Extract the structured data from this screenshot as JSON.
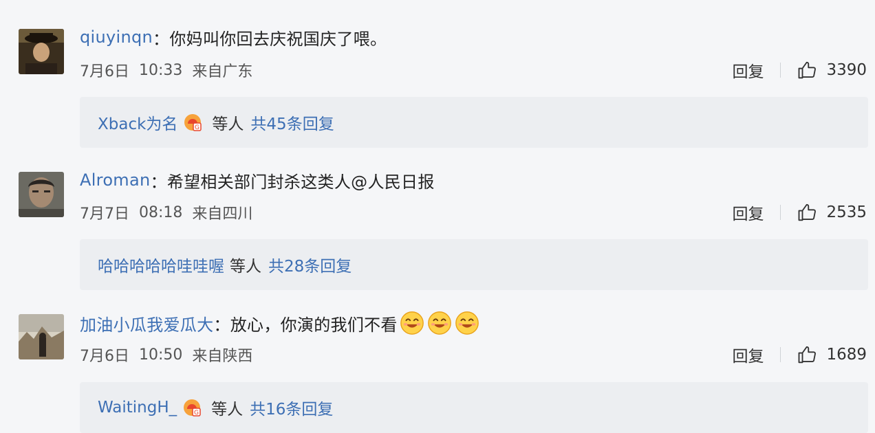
{
  "comments": [
    {
      "username": "qiuyinqn",
      "separator": "：",
      "text": "你妈叫你回去庆祝国庆了喂。",
      "mention": "",
      "date": "7月6日",
      "time": "10:33",
      "location": "来自广东",
      "reply_label": "回复",
      "likes": "3390",
      "replies": {
        "name": "Xback为名",
        "has_badge": true,
        "others_label": "等人",
        "count_label": "共45条回复"
      }
    },
    {
      "username": "Alroman",
      "separator": "：",
      "text": "希望相关部门封杀这类人 ",
      "mention": "@人民日报",
      "date": "7月7日",
      "time": "08:18",
      "location": "来自四川",
      "reply_label": "回复",
      "likes": "2535",
      "replies": {
        "name": "哈哈哈哈哈哇哇喔",
        "has_badge": false,
        "others_label": "等人",
        "count_label": "共28条回复"
      }
    },
    {
      "username": "加油小瓜我爱瓜大",
      "separator": "：",
      "text": "放心，你演的我们不看",
      "mention": "",
      "emojis": [
        "smile-emoji",
        "smile-emoji",
        "smile-emoji"
      ],
      "date": "7月6日",
      "time": "10:50",
      "location": "来自陕西",
      "reply_label": "回复",
      "likes": "1689",
      "replies": {
        "name": "WaitingH_",
        "has_badge": true,
        "others_label": "等人",
        "count_label": "共16条回复"
      }
    }
  ],
  "colors": {
    "username": "#3d6fb4",
    "background": "#f5f6f8",
    "reply_box": "#eceef1"
  }
}
